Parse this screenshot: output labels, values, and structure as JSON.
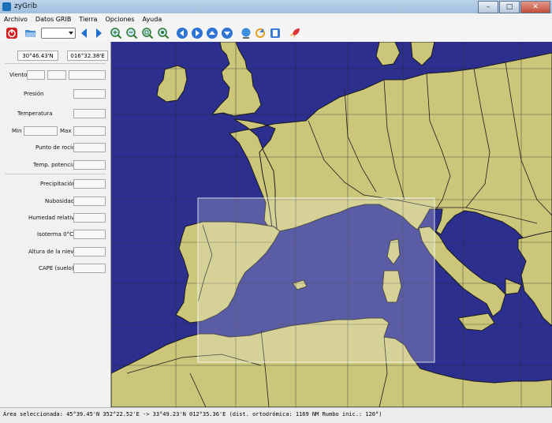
{
  "window": {
    "title": "zyGrib"
  },
  "menu": [
    "Archivo",
    "Datos GRIB",
    "Tierra",
    "Opciones",
    "Ayuda"
  ],
  "toolbar": {
    "items": [
      {
        "name": "exit-button",
        "icon": "power-icon"
      },
      {
        "name": "open-file-button",
        "icon": "open-folder-icon"
      },
      {
        "name": "date-combo",
        "icon": "chevron-down-icon"
      },
      {
        "name": "previous-button",
        "icon": "arrow-left-icon"
      },
      {
        "name": "next-button",
        "icon": "arrow-right-icon"
      },
      {
        "name": "zoom-in-button",
        "icon": "zoom-in-icon"
      },
      {
        "name": "zoom-out-button",
        "icon": "zoom-out-icon"
      },
      {
        "name": "zoom-selection-button",
        "icon": "zoom-fit-icon"
      },
      {
        "name": "zoom-all-button",
        "icon": "zoom-all-icon"
      },
      {
        "name": "pan-left-button",
        "icon": "pan-left-icon"
      },
      {
        "name": "pan-right-button",
        "icon": "pan-right-icon"
      },
      {
        "name": "pan-up-button",
        "icon": "pan-up-icon"
      },
      {
        "name": "pan-down-button",
        "icon": "pan-down-icon"
      },
      {
        "name": "globe-button",
        "icon": "globe-icon"
      },
      {
        "name": "refresh-button",
        "icon": "refresh-icon"
      },
      {
        "name": "metar-button",
        "icon": "document-icon"
      },
      {
        "name": "rocket-button",
        "icon": "rocket-icon"
      }
    ]
  },
  "panel": {
    "latitude": "30°46.43'N",
    "longitude": "016°32.38'E",
    "labels": {
      "viento": "Viento",
      "presion": "Presión",
      "temperatura": "Temperatura",
      "min": "Min",
      "max": "Max",
      "punto_rocio": "Punto de rocío",
      "temp_potencial": "Temp. potencial",
      "precipitacion": "Precipitación",
      "nubosidad": "Nubosidad",
      "humedad": "Humedad relativa",
      "isoterma": "Isoterma 0°C",
      "altura_nieve": "Altura de la nieve",
      "cape": "CAPE (suelo)"
    }
  },
  "map": {
    "ocean_color": "#2c2f8e",
    "land_color": "#cbc67a",
    "border_color": "#1a1a1a"
  },
  "status": "Área seleccionada:  45°39.45'N  352°22.52'E ->  33°49.23'N  012°35.36'E   (dist. ortodrómica: 1169 NM  Rumbo inic.: 120°)"
}
